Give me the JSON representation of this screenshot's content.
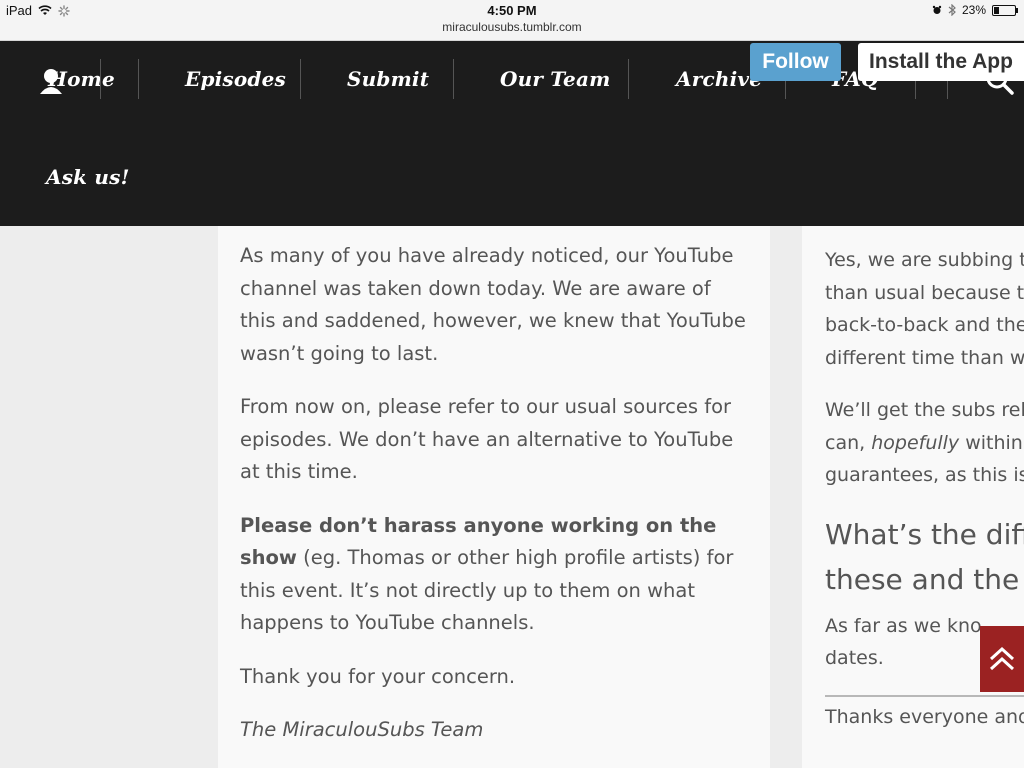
{
  "status_bar": {
    "device": "iPad",
    "time": "4:50 PM",
    "url": "miraculousubs.tumblr.com",
    "battery": "23%",
    "battery_level": 0.23
  },
  "nav": {
    "items": [
      "Home",
      "Episodes",
      "Submit",
      "Our Team",
      "Archive",
      "FAQ",
      "Ask us!"
    ],
    "follow_label": "Follow",
    "install_label": "Install the App"
  },
  "post": {
    "p1": "As many of you have already noticed, our YouTube channel was taken down today. We are aware of this and saddened, however, we knew that YouTube wasn’t going to last.",
    "p2": "From now on, please refer to our usual sources for episodes. We don’t have an alternative to YouTube at this time.",
    "p3_bold": "Please don’t harass anyone working on the show",
    "p3_rest": " (eg. Thomas or other high profile artists) for this event. It’s not directly up to them on what happens to YouTube channels.",
    "p4": "Thank you for your concern.",
    "signature": "The MiraculouSubs Team"
  },
  "side_post": {
    "line1": "Yes, we are subbing t",
    "line2": "than usual because t",
    "line3": "back-to-back and the",
    "line4": "different time than we",
    "line5": "We’ll get the subs rele",
    "line6_pre": "can, ",
    "line6_em": "hopefully",
    "line6_post": " within",
    "line7": "guarantees, as this is",
    "heading1": "What’s the diff",
    "heading2": "these and the",
    "line8": "As far as we kno",
    "line9": "dates.",
    "footer": "Thanks everyone and"
  },
  "colors": {
    "nav_bg": "#1c1c1c",
    "follow_bg": "#5aa1cf",
    "to_top_bg": "#9b2222"
  }
}
